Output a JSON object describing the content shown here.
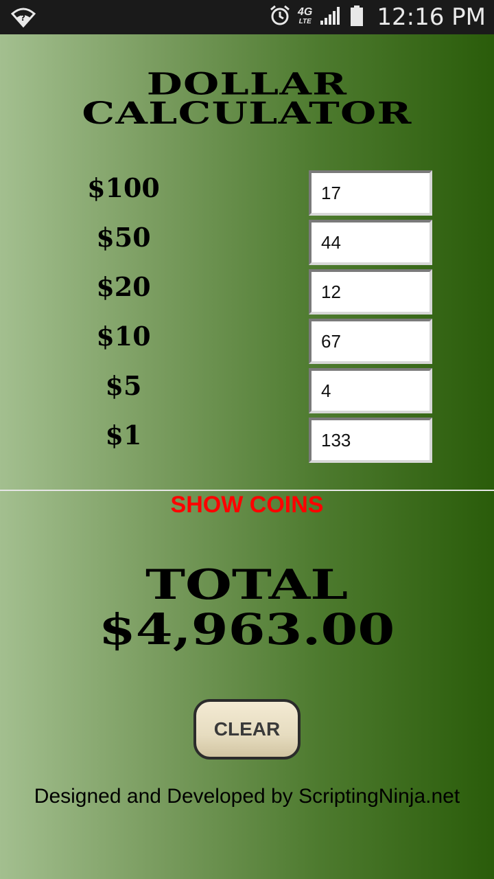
{
  "status_bar": {
    "time": "12:16 PM",
    "network": "4G",
    "network_sub": "LTE",
    "icons": [
      "wifi-icon",
      "alarm-icon",
      "signal-icon",
      "battery-icon"
    ]
  },
  "app": {
    "title_line1": "DOLLAR",
    "title_line2": "CALCULATOR",
    "denominations": [
      {
        "label": "$100",
        "value": "17"
      },
      {
        "label": "$50",
        "value": "44"
      },
      {
        "label": "$20",
        "value": "12"
      },
      {
        "label": "$10",
        "value": "67"
      },
      {
        "label": "$5",
        "value": "4"
      },
      {
        "label": "$1",
        "value": "133"
      }
    ],
    "show_coins_label": "SHOW COINS",
    "total_label": "TOTAL",
    "total_value": "$4,963.00",
    "clear_label": "CLEAR",
    "footer": "Designed and Developed by ScriptingNinja.net"
  },
  "colors": {
    "gradient_left": "#a3bf8f",
    "gradient_right": "#2a5c0a",
    "show_coins": "#ff0000",
    "status_bar_bg": "#1a1a1a"
  }
}
